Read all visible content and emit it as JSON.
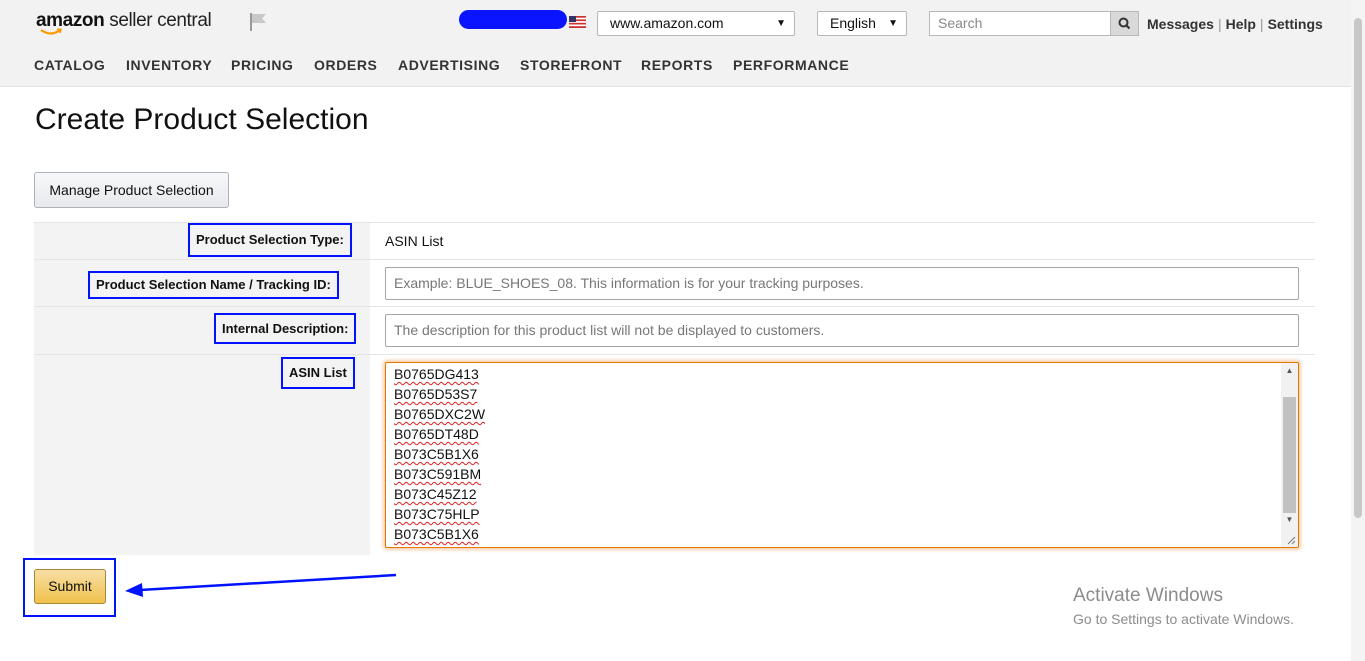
{
  "header": {
    "logo_bold": "amazon",
    "logo_rest": " seller central",
    "marketplace": "www.amazon.com",
    "language": "English",
    "search_placeholder": "Search",
    "links": [
      "Messages",
      "Help",
      "Settings"
    ]
  },
  "nav": [
    "CATALOG",
    "INVENTORY",
    "PRICING",
    "ORDERS",
    "ADVERTISING",
    "STOREFRONT",
    "REPORTS",
    "PERFORMANCE"
  ],
  "page_title": "Create Product Selection",
  "manage_button": "Manage Product Selection",
  "form": {
    "type_label": "Product Selection Type:",
    "type_value": "ASIN List",
    "name_label": "Product Selection Name / Tracking ID:",
    "name_placeholder": "Example: BLUE_SHOES_08. This information is for your tracking purposes.",
    "desc_label": "Internal Description:",
    "desc_placeholder": "The description for this product list will not be displayed to customers.",
    "asin_label": "ASIN List",
    "asins": [
      "B0765DG413",
      "B0765D53S7",
      "B0765DXC2W",
      "B0765DT48D",
      "B073C5B1X6",
      "B073C591BM",
      "B073C45Z12",
      "B073C75HLP",
      "B073C5B1X6"
    ]
  },
  "submit_label": "Submit",
  "watermark": {
    "title": "Activate Windows",
    "subtitle": "Go to Settings to activate Windows."
  },
  "colors": {
    "annotation_blue": "#0012ff",
    "focus_orange": "#e77600",
    "submit_yellow": "#f0c14b"
  }
}
